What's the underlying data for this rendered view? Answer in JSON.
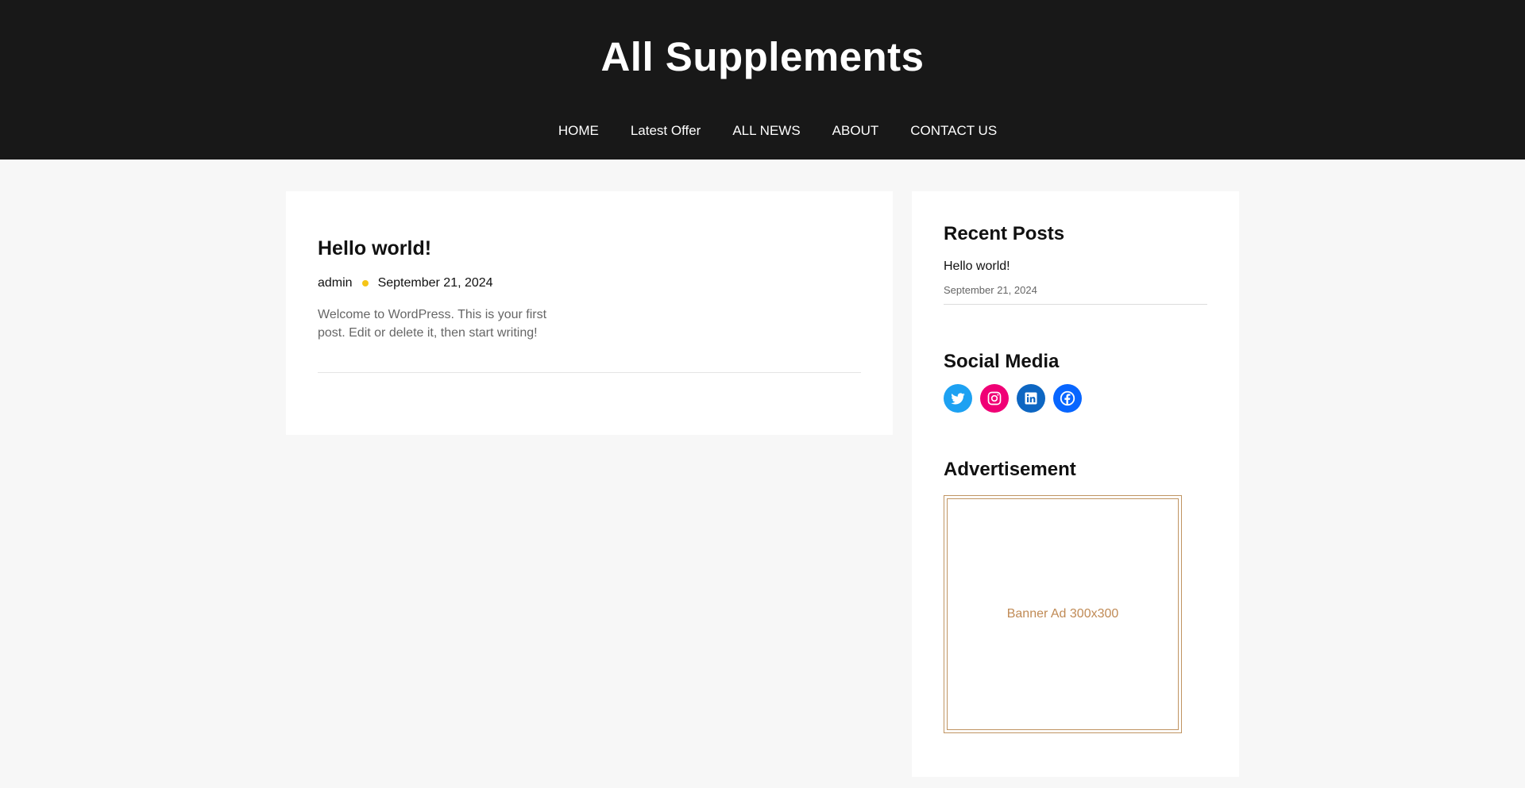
{
  "site": {
    "title": "All Supplements"
  },
  "nav": {
    "items": [
      {
        "label": "HOME"
      },
      {
        "label": "Latest Offer"
      },
      {
        "label": "ALL NEWS"
      },
      {
        "label": "ABOUT"
      },
      {
        "label": "CONTACT US"
      }
    ]
  },
  "post": {
    "title": "Hello world!",
    "author": "admin",
    "date": "September 21, 2024",
    "excerpt": "Welcome to WordPress. This is your first post. Edit or delete it, then start writing!"
  },
  "sidebar": {
    "recent_posts": {
      "title": "Recent Posts",
      "items": [
        {
          "label": "Hello world!",
          "date": "September 21, 2024"
        }
      ]
    },
    "social": {
      "title": "Social Media",
      "items": [
        {
          "icon": "twitter-icon",
          "color": "#1da1f2"
        },
        {
          "icon": "instagram-icon",
          "color": "#f00075"
        },
        {
          "icon": "linkedin-icon",
          "color": "#0d66c2"
        },
        {
          "icon": "facebook-icon",
          "color": "#0866ff"
        }
      ]
    },
    "advertisement": {
      "title": "Advertisement",
      "banner_text": "Banner Ad 300x300"
    }
  },
  "colors": {
    "header_bg": "#181818",
    "page_bg": "#f7f7f7",
    "meta_dot": "#f5c518",
    "ad_accent": "#c09462"
  }
}
